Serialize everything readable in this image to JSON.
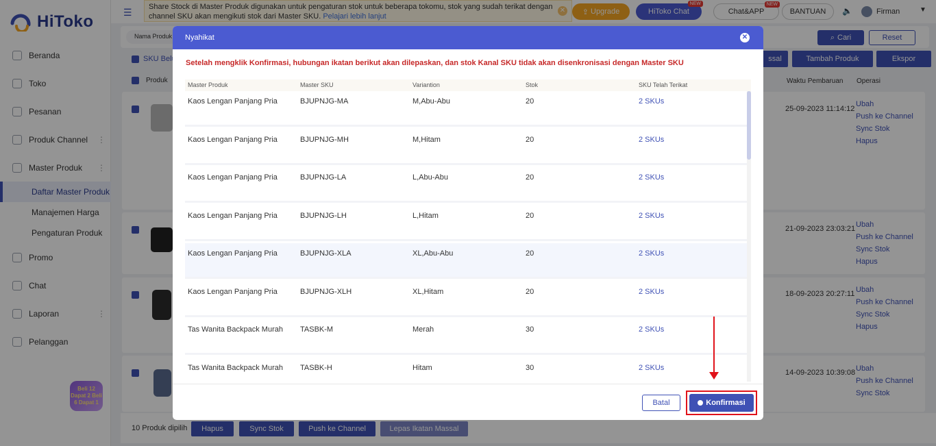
{
  "app": {
    "logo_text": "HiToko"
  },
  "sidebar": {
    "items": [
      {
        "label": "Beranda",
        "icon": "monitor-icon"
      },
      {
        "label": "Toko",
        "icon": "store-icon"
      },
      {
        "label": "Pesanan",
        "icon": "clipboard-icon"
      },
      {
        "label": "Produk Channel",
        "icon": "grid-icon"
      },
      {
        "label": "Master Produk",
        "icon": "box-icon"
      }
    ],
    "sub_items": [
      "Daftar Master Produk",
      "Manajemen Harga",
      "Pengaturan Produk"
    ],
    "items_after": [
      {
        "label": "Promo",
        "icon": "promo-icon"
      },
      {
        "label": "Chat",
        "icon": "chat-icon"
      },
      {
        "label": "Laporan",
        "icon": "report-icon"
      },
      {
        "label": "Pelanggan",
        "icon": "users-icon"
      }
    ],
    "promo_badge": "Beli 12 Dapat 2 Beli 6 Dapat 1"
  },
  "topbar": {
    "notice_text": "Share Stock di Master Produk digunakan untuk pengaturan stok untuk beberapa tokomu, stok yang sudah terikat dengan channel SKU akan mengikuti stok dari Master SKU.",
    "notice_link": "Pelajari lebih lanjut",
    "upgrade": "Upgrade",
    "hitoko_chat": "HiToko Chat",
    "chat_app": "Chat&APP",
    "new_tag": "NEW",
    "bantuan": "BANTUAN",
    "user": "Firman"
  },
  "filter": {
    "field_label": "Nama Produk",
    "search": "Cari",
    "reset": "Reset",
    "sku_label": "SKU Belu",
    "massal": "ssal",
    "tambah": "Tambah Produk",
    "ekspor": "Ekspor",
    "col_produk": "Produk",
    "col_waktu": "Waktu Pembaruan",
    "col_operasi": "Operasi"
  },
  "bg_rows": [
    {
      "time": "25-09-2023 11:14:12"
    },
    {
      "time": "21-09-2023 23:03:21"
    },
    {
      "time": "18-09-2023 20:27:11"
    },
    {
      "time": "14-09-2023 10:39:08"
    }
  ],
  "ops": [
    "Ubah",
    "Push ke Channel",
    "Sync Stok",
    "Hapus"
  ],
  "bottombar": {
    "selected": "10 Produk dipilih",
    "hapus": "Hapus",
    "sync": "Sync Stok",
    "push": "Push ke Channel",
    "lepas": "Lepas Ikatan Massal"
  },
  "modal": {
    "title": "Nyahikat",
    "warning": "Setelah mengklik Konfirmasi, hubungan ikatan berikut akan dilepaskan, dan stok Kanal SKU tidak akan disenkronisasi dengan Master SKU",
    "headers": [
      "Master Produk",
      "Master SKU",
      "Variantion",
      "Stok",
      "SKU Telah Terikat"
    ],
    "rows": [
      {
        "produk": "Kaos Lengan Panjang Pria",
        "sku": "BJUPNJG-MA",
        "var": "M,Abu-Abu",
        "stok": "20",
        "terikat": "2 SKUs"
      },
      {
        "produk": "Kaos Lengan Panjang Pria",
        "sku": "BJUPNJG-MH",
        "var": "M,Hitam",
        "stok": "20",
        "terikat": "2 SKUs"
      },
      {
        "produk": "Kaos Lengan Panjang Pria",
        "sku": "BJUPNJG-LA",
        "var": "L,Abu-Abu",
        "stok": "20",
        "terikat": "2 SKUs"
      },
      {
        "produk": "Kaos Lengan Panjang Pria",
        "sku": "BJUPNJG-LH",
        "var": "L,Hitam",
        "stok": "20",
        "terikat": "2 SKUs"
      },
      {
        "produk": "Kaos Lengan Panjang Pria",
        "sku": "BJUPNJG-XLA",
        "var": "XL,Abu-Abu",
        "stok": "20",
        "terikat": "2 SKUs"
      },
      {
        "produk": "Kaos Lengan Panjang Pria",
        "sku": "BJUPNJG-XLH",
        "var": "XL,Hitam",
        "stok": "20",
        "terikat": "2 SKUs"
      },
      {
        "produk": "Tas Wanita Backpack Murah",
        "sku": "TASBK-M",
        "var": "Merah",
        "stok": "30",
        "terikat": "2 SKUs"
      },
      {
        "produk": "Tas Wanita Backpack Murah",
        "sku": "TASBK-H",
        "var": "Hitam",
        "stok": "30",
        "terikat": "2 SKUs"
      }
    ],
    "cancel": "Batal",
    "confirm": "Konfirmasi"
  },
  "colors": {
    "accent": "#3f51b5",
    "header": "#4b5bd1",
    "warning": "#c62828",
    "highlight": "#e0121a"
  }
}
